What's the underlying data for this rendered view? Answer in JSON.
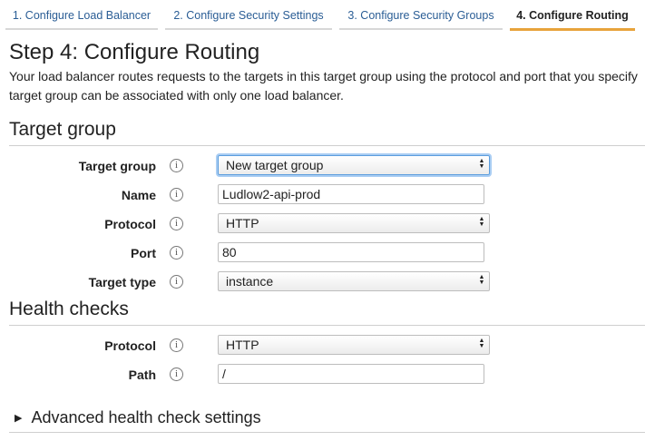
{
  "tabs": [
    {
      "label": "1. Configure Load Balancer"
    },
    {
      "label": "2. Configure Security Settings"
    },
    {
      "label": "3. Configure Security Groups"
    },
    {
      "label": "4. Configure Routing"
    }
  ],
  "page": {
    "title": "Step 4: Configure Routing",
    "description_line1": "Your load balancer routes requests to the targets in this target group using the protocol and port that you specify",
    "description_line2": "target group can be associated with only one load balancer."
  },
  "target_group": {
    "section_title": "Target group",
    "fields": {
      "target_group": {
        "label": "Target group",
        "value": "New target group"
      },
      "name": {
        "label": "Name",
        "value": "Ludlow2-api-prod"
      },
      "protocol": {
        "label": "Protocol",
        "value": "HTTP"
      },
      "port": {
        "label": "Port",
        "value": "80"
      },
      "target_type": {
        "label": "Target type",
        "value": "instance"
      }
    }
  },
  "health_checks": {
    "section_title": "Health checks",
    "fields": {
      "protocol": {
        "label": "Protocol",
        "value": "HTTP"
      },
      "path": {
        "label": "Path",
        "value": "/"
      }
    }
  },
  "advanced": {
    "label": "Advanced health check settings"
  },
  "icons": {
    "info": "i",
    "select_arrows_up": "▲",
    "select_arrows_down": "▼",
    "expand": "▶"
  },
  "colors": {
    "link": "#2a5d95",
    "active_tab_accent": "#e8a33b",
    "focus_ring": "#5b9ddd"
  }
}
